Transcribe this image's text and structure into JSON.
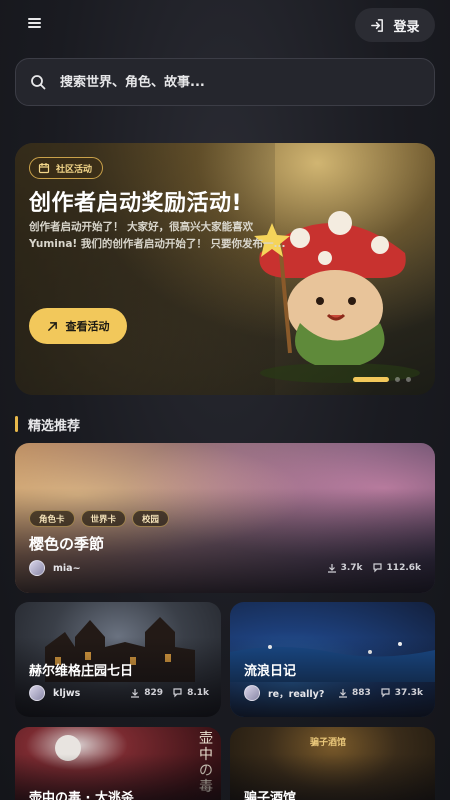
{
  "header": {
    "menu_icon": "hamburger-menu-icon",
    "login_icon": "login-arrow-icon",
    "login_label": "登录"
  },
  "search": {
    "icon": "search-icon",
    "placeholder": "搜索世界、角色、故事..."
  },
  "banner": {
    "tag": "社区活动",
    "tag_icon": "calendar-icon",
    "title": "创作者启动奖励活动!",
    "description": "创作者启动开始了！ 大家好，很高兴大家能喜欢Yumina! 我们的创作者启动开始了！ 只要你发布一...",
    "button_label": "查看活动",
    "button_icon": "arrow-up-right-icon",
    "slide_count": 3,
    "active_slide": 1
  },
  "section": {
    "title": "精选推荐"
  },
  "featured": {
    "tags": [
      "角色卡",
      "世界卡",
      "校园"
    ],
    "title": "樱色の季節",
    "author": "mia~",
    "views": "3.7k",
    "chats": "112.6k"
  },
  "cards": [
    {
      "title": "赫尔维格庄园七日",
      "author": "kljws",
      "views": "829",
      "chats": "8.1k"
    },
    {
      "title": "流浪日记",
      "author": "re，really?",
      "views": "883",
      "chats": "37.3k"
    },
    {
      "title": "壶中の毒 · 大逃杀",
      "overlay_text": "壶中の毒"
    },
    {
      "title": "骗子酒馆",
      "overlay_text": "骗子酒馆"
    }
  ],
  "colors": {
    "accent": "#f2c85b",
    "background": "#1a1b21",
    "surface": "#25262d"
  }
}
